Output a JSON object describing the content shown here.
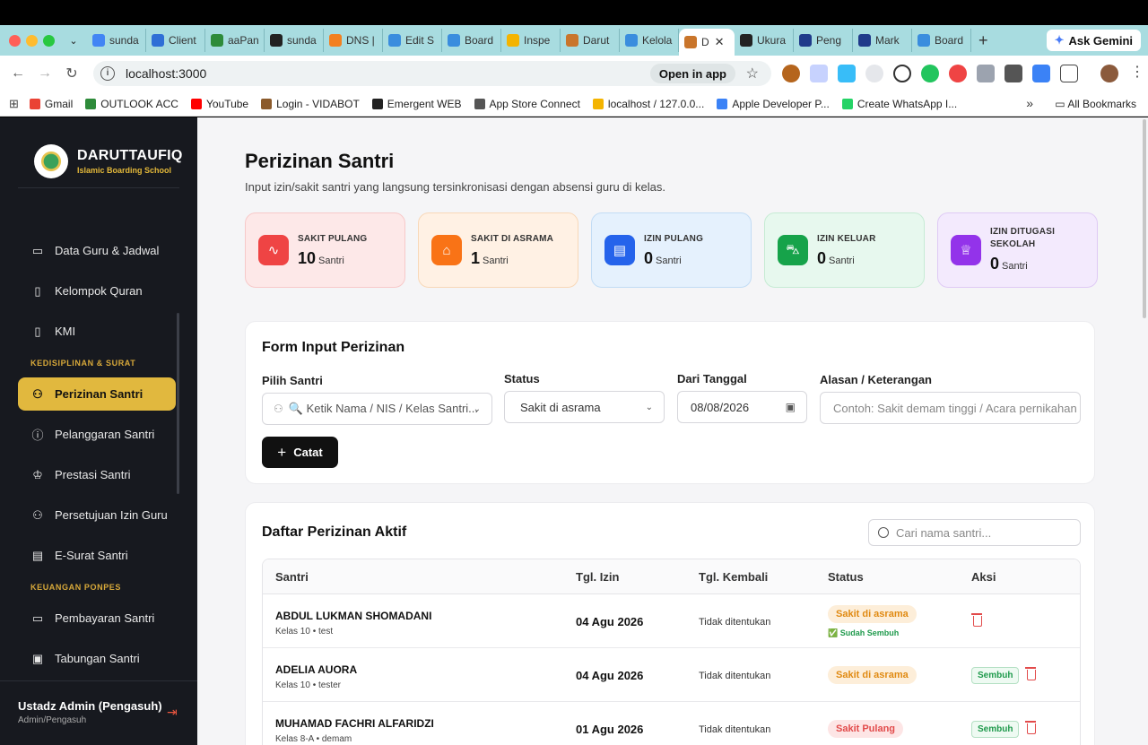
{
  "browser": {
    "tabs": [
      {
        "label": "sunda",
        "color": "#4285f4"
      },
      {
        "label": "Client",
        "color": "#2f6fd6"
      },
      {
        "label": "aaPan",
        "color": "#2e8b3a"
      },
      {
        "label": "sunda",
        "color": "#222222"
      },
      {
        "label": "DNS |",
        "color": "#f38020"
      },
      {
        "label": "Edit S",
        "color": "#3a8dde"
      },
      {
        "label": "Board",
        "color": "#3a8dde"
      },
      {
        "label": "Inspe",
        "color": "#f4b400"
      },
      {
        "label": "Darut",
        "color": "#c9752b"
      },
      {
        "label": "Kelola",
        "color": "#3a8dde"
      },
      {
        "label": "D",
        "color": "#c9752b",
        "active": true
      },
      {
        "label": "Ukura",
        "color": "#222222"
      },
      {
        "label": "Peng",
        "color": "#1f3a8a"
      },
      {
        "label": "Mark",
        "color": "#1f3a8a"
      },
      {
        "label": "Board",
        "color": "#3a8dde"
      }
    ],
    "ask_gemini": "Ask Gemini",
    "url": "localhost:3000",
    "open_in_app": "Open in app",
    "bookmarks": [
      "Gmail",
      "OUTLOOK ACC",
      "YouTube",
      "Login - VIDABOT",
      "Emergent WEB",
      "App Store Connect",
      "localhost / 127.0.0...",
      "Apple Developer P...",
      "Create WhatsApp I..."
    ],
    "all_bookmarks": "All Bookmarks"
  },
  "sidebar": {
    "brand": "DARUTTAUFIQ",
    "brand_sub": "Islamic Boarding School",
    "items_a": [
      "Data Guru & Jadwal",
      "Kelompok Quran",
      "KMI"
    ],
    "section_disiplin": "KEDISIPLINAN & SURAT",
    "items_b": [
      "Perizinan Santri",
      "Pelanggaran Santri",
      "Prestasi Santri",
      "Persetujuan Izin Guru",
      "E-Surat Santri"
    ],
    "section_keuangan": "KEUANGAN PONPES",
    "items_c": [
      "Pembayaran Santri",
      "Tabungan Santri"
    ],
    "user_name": "Ustadz Admin (Pengasuh)",
    "user_role": "Admin/Pengasuh"
  },
  "page": {
    "title": "Perizinan Santri",
    "subtitle": "Input izin/sakit santri yang langsung tersinkronisasi dengan absensi guru di kelas."
  },
  "stats": [
    {
      "label": "SAKIT PULANG",
      "value": "10",
      "unit": "Santri",
      "accent": "#ef4444"
    },
    {
      "label": "SAKIT DI ASRAMA",
      "value": "1",
      "unit": "Santri",
      "accent": "#f97316"
    },
    {
      "label": "IZIN PULANG",
      "value": "0",
      "unit": "Santri",
      "accent": "#2563eb"
    },
    {
      "label": "IZIN KELUAR",
      "value": "0",
      "unit": "Santri",
      "accent": "#16a34a"
    },
    {
      "label": "IZIN DITUGASI SEKOLAH",
      "value": "0",
      "unit": "Santri",
      "accent": "#9333ea"
    }
  ],
  "form": {
    "title": "Form Input Perizinan",
    "santri_label": "Pilih Santri",
    "santri_placeholder": "🔍 Ketik Nama / NIS / Kelas Santri...",
    "status_label": "Status",
    "status_value": "Sakit di asrama",
    "date_label": "Dari Tanggal",
    "date_value": "08/08/2026",
    "reason_label": "Alasan / Keterangan",
    "reason_placeholder": "Contoh: Sakit demam tinggi / Acara pernikahan",
    "submit": "Catat"
  },
  "list": {
    "title": "Daftar Perizinan Aktif",
    "search_placeholder": "Cari nama santri...",
    "columns": [
      "Santri",
      "Tgl. Izin",
      "Tgl. Kembali",
      "Status",
      "Aksi"
    ],
    "rows": [
      {
        "name": "ABDUL LUKMAN SHOMADANI",
        "meta": "Kelas 10 • test",
        "date": "04 Agu 2026",
        "return": "Tidak ditentukan",
        "status": "Sakit di asrama",
        "note": "✅ Sudah Sembuh",
        "action": ""
      },
      {
        "name": "ADELIA AUORA",
        "meta": "Kelas 10 • tester",
        "date": "04 Agu 2026",
        "return": "Tidak ditentukan",
        "status": "Sakit di asrama",
        "note": "",
        "action": "Sembuh"
      },
      {
        "name": "MUHAMAD FACHRI ALFARIDZI",
        "meta": "Kelas 8-A • demam",
        "date": "01 Agu 2026",
        "return": "Tidak ditentukan",
        "status": "Sakit Pulang",
        "note": "",
        "action": "Sembuh"
      }
    ]
  }
}
